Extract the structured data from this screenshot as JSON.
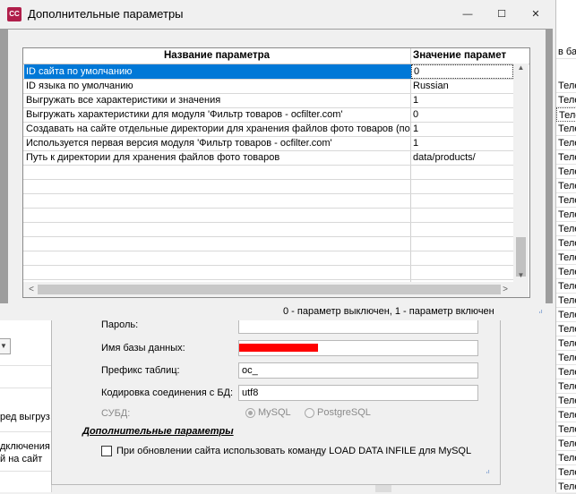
{
  "window": {
    "title": "Дополнительные параметры",
    "app_icon": "CC",
    "minimize_glyph": "—",
    "maximize_glyph": "☐",
    "close_glyph": "✕"
  },
  "grid": {
    "columns": [
      "Название параметра",
      "Значение парамет"
    ],
    "rows": [
      {
        "name": "ID сайта по умолчанию",
        "value": "0"
      },
      {
        "name": "ID языка по умолчанию",
        "value": "Russian"
      },
      {
        "name": "Выгружать все характеристики и значения",
        "value": "1"
      },
      {
        "name": "Выгружать характеристики для модуля 'Фильтр товаров - ocfilter.com'",
        "value": "0"
      },
      {
        "name": "Создавать на сайте отдельные директории для хранения файлов фото товаров (по",
        "value": "1"
      },
      {
        "name": "Используется первая версия модуля 'Фильтр товаров - ocfilter.com'",
        "value": "1"
      },
      {
        "name": "Путь к директории для хранения файлов фото товаров",
        "value": "data/products/"
      }
    ],
    "selected_row": 0
  },
  "status": {
    "text": "0 - параметр выключен, 1 - параметр включен"
  },
  "settings": {
    "password_label": "Пароль:",
    "db_name_label": "Имя базы данных:",
    "prefix_label": "Префикс таблиц:",
    "prefix_value": "oc_",
    "encoding_label": "Кодировка соединения с БД:",
    "encoding_value": "utf8",
    "dbms_label": "СУБД:",
    "mysql_label": "MySQL",
    "postgres_label": "PostgreSQL",
    "extra_params_link": "Дополнительные параметры",
    "load_data_checkbox_label": "При обновлении сайта использовать команду LOAD DATA INFILE для MySQL"
  },
  "background_left": {
    "line1": "ред выгруз",
    "line2": "дключения",
    "line3": "й на сайт"
  },
  "background_right": {
    "header": "в ба",
    "cell": "Теле"
  },
  "colors": {
    "selection": "#0078d7",
    "redacted": "#ff0000"
  }
}
